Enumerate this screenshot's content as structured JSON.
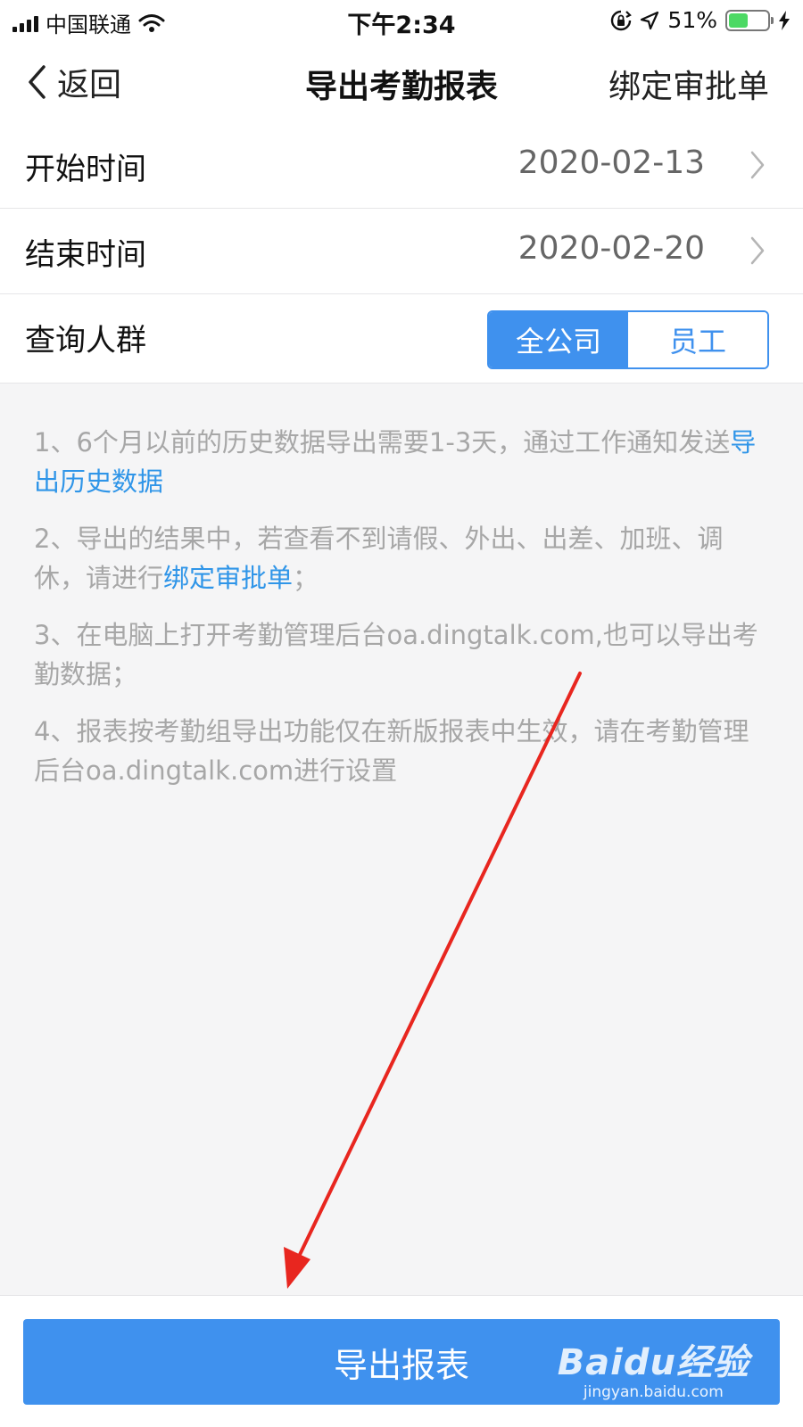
{
  "status_bar": {
    "carrier": "中国联通",
    "time": "下午2:34",
    "battery_percent": "51%",
    "battery_level": 0.51
  },
  "nav": {
    "back_label": "返回",
    "title": "导出考勤报表",
    "right_action": "绑定审批单"
  },
  "form": {
    "start": {
      "label": "开始时间",
      "value": "2020-02-13"
    },
    "end": {
      "label": "结束时间",
      "value": "2020-02-20"
    },
    "scope": {
      "label": "查询人群",
      "options": [
        "全公司",
        "员工"
      ],
      "selected": "全公司"
    }
  },
  "notes": [
    {
      "before": "1、6个月以前的历史数据导出需要1-3天，通过工作通知发送",
      "link": "导出历史数据",
      "after": ""
    },
    {
      "before": "2、导出的结果中，若查看不到请假、外出、出差、加班、调休，请进行",
      "link": "绑定审批单",
      "after": "；"
    },
    {
      "before": "3、在电脑上打开考勤管理后台oa.dingtalk.com,也可以导出考勤数据；",
      "link": "",
      "after": ""
    },
    {
      "before": "4、报表按考勤组导出功能仅在新版报表中生效，请在考勤管理后台oa.dingtalk.com进行设置",
      "link": "",
      "after": ""
    }
  ],
  "export_button": "导出报表",
  "colors": {
    "accent": "#3f91ee",
    "link": "#2f95e8",
    "annotation_arrow": "#e8261f"
  },
  "watermark": {
    "main": "Baidu经验",
    "sub": "jingyan.baidu.com"
  }
}
